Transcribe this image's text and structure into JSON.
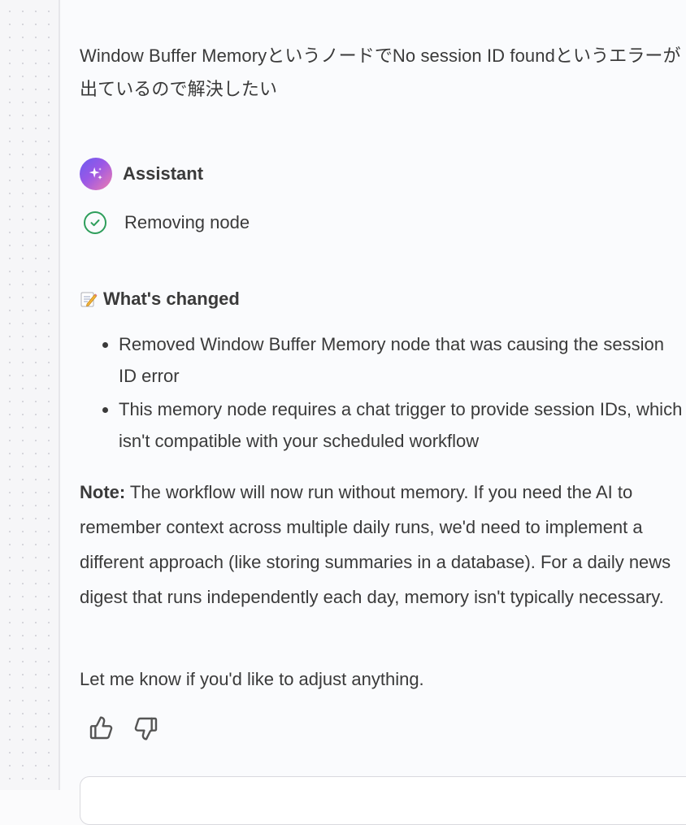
{
  "user_message": {
    "text": "Window Buffer MemoryというノードでNo session ID foundというエラーが出ているので解決したい"
  },
  "assistant": {
    "name": "Assistant",
    "avatar_icon": "sparkle-icon",
    "tool_status": {
      "label": "Removing node",
      "icon": "check-circle-icon",
      "color": "#2e9e5b"
    },
    "changes": {
      "heading": "What's changed",
      "heading_icon": "memo-emoji-icon",
      "items": [
        "Removed Window Buffer Memory node that was causing the session ID error",
        "This memory node requires a chat trigger to provide session IDs, which isn't compatible with your scheduled workflow"
      ]
    },
    "note": {
      "label": "Note:",
      "text": " The workflow will now run without memory. If you need the AI to remember context across multiple daily runs, we'd need to implement a different approach (like storing summaries in a database). For a daily news digest that runs independently each day, memory isn't typically necessary."
    },
    "closing": "Let me know if you'd like to adjust anything.",
    "feedback": {
      "thumbs_up_icon": "thumbs-up-icon",
      "thumbs_down_icon": "thumbs-down-icon"
    }
  },
  "colors": {
    "text": "#3a3a3a",
    "success": "#2e9e5b",
    "avatar_gradient": [
      "#6a5cf0",
      "#f07dae"
    ],
    "panel_background": "#fafbfd"
  }
}
